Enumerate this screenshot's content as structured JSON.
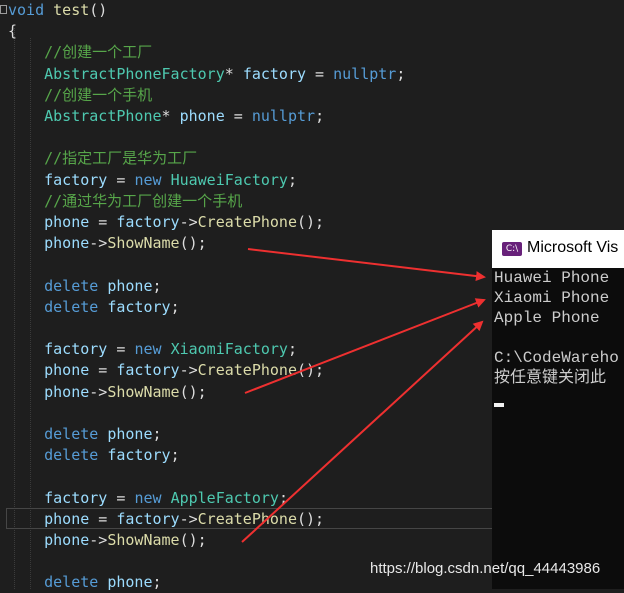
{
  "editor": {
    "lines": [
      [
        {
          "c": "kw",
          "t": "void"
        },
        {
          "c": "plain",
          "t": " "
        },
        {
          "c": "fn",
          "t": "test"
        },
        {
          "c": "plain",
          "t": "()"
        }
      ],
      [
        {
          "c": "plain",
          "t": "{"
        }
      ],
      [
        {
          "c": "plain",
          "t": "    "
        },
        {
          "c": "comment",
          "t": "//创建一个工厂"
        }
      ],
      [
        {
          "c": "plain",
          "t": "    "
        },
        {
          "c": "type",
          "t": "AbstractPhoneFactory"
        },
        {
          "c": "plain",
          "t": "* "
        },
        {
          "c": "var",
          "t": "factory"
        },
        {
          "c": "plain",
          "t": " = "
        },
        {
          "c": "kw",
          "t": "nullptr"
        },
        {
          "c": "plain",
          "t": ";"
        }
      ],
      [
        {
          "c": "plain",
          "t": "    "
        },
        {
          "c": "comment",
          "t": "//创建一个手机"
        }
      ],
      [
        {
          "c": "plain",
          "t": "    "
        },
        {
          "c": "type",
          "t": "AbstractPhone"
        },
        {
          "c": "plain",
          "t": "* "
        },
        {
          "c": "var",
          "t": "phone"
        },
        {
          "c": "plain",
          "t": " = "
        },
        {
          "c": "kw",
          "t": "nullptr"
        },
        {
          "c": "plain",
          "t": ";"
        }
      ],
      [],
      [
        {
          "c": "plain",
          "t": "    "
        },
        {
          "c": "comment",
          "t": "//指定工厂是华为工厂"
        }
      ],
      [
        {
          "c": "plain",
          "t": "    "
        },
        {
          "c": "var",
          "t": "factory"
        },
        {
          "c": "plain",
          "t": " = "
        },
        {
          "c": "kw",
          "t": "new"
        },
        {
          "c": "plain",
          "t": " "
        },
        {
          "c": "type",
          "t": "HuaweiFactory"
        },
        {
          "c": "plain",
          "t": ";"
        }
      ],
      [
        {
          "c": "plain",
          "t": "    "
        },
        {
          "c": "comment",
          "t": "//通过华为工厂创建一个手机"
        }
      ],
      [
        {
          "c": "plain",
          "t": "    "
        },
        {
          "c": "var",
          "t": "phone"
        },
        {
          "c": "plain",
          "t": " = "
        },
        {
          "c": "var",
          "t": "factory"
        },
        {
          "c": "plain",
          "t": "->"
        },
        {
          "c": "fn",
          "t": "CreatePhone"
        },
        {
          "c": "plain",
          "t": "();"
        }
      ],
      [
        {
          "c": "plain",
          "t": "    "
        },
        {
          "c": "var",
          "t": "phone"
        },
        {
          "c": "plain",
          "t": "->"
        },
        {
          "c": "fn",
          "t": "ShowName"
        },
        {
          "c": "plain",
          "t": "();"
        }
      ],
      [],
      [
        {
          "c": "plain",
          "t": "    "
        },
        {
          "c": "kw",
          "t": "delete"
        },
        {
          "c": "plain",
          "t": " "
        },
        {
          "c": "var",
          "t": "phone"
        },
        {
          "c": "plain",
          "t": ";"
        }
      ],
      [
        {
          "c": "plain",
          "t": "    "
        },
        {
          "c": "kw",
          "t": "delete"
        },
        {
          "c": "plain",
          "t": " "
        },
        {
          "c": "var",
          "t": "factory"
        },
        {
          "c": "plain",
          "t": ";"
        }
      ],
      [],
      [
        {
          "c": "plain",
          "t": "    "
        },
        {
          "c": "var",
          "t": "factory"
        },
        {
          "c": "plain",
          "t": " = "
        },
        {
          "c": "kw",
          "t": "new"
        },
        {
          "c": "plain",
          "t": " "
        },
        {
          "c": "type",
          "t": "XiaomiFactory"
        },
        {
          "c": "plain",
          "t": ";"
        }
      ],
      [
        {
          "c": "plain",
          "t": "    "
        },
        {
          "c": "var",
          "t": "phone"
        },
        {
          "c": "plain",
          "t": " = "
        },
        {
          "c": "var",
          "t": "factory"
        },
        {
          "c": "plain",
          "t": "->"
        },
        {
          "c": "fn",
          "t": "CreatePhone"
        },
        {
          "c": "plain",
          "t": "();"
        }
      ],
      [
        {
          "c": "plain",
          "t": "    "
        },
        {
          "c": "var",
          "t": "phone"
        },
        {
          "c": "plain",
          "t": "->"
        },
        {
          "c": "fn",
          "t": "ShowName"
        },
        {
          "c": "plain",
          "t": "();"
        }
      ],
      [],
      [
        {
          "c": "plain",
          "t": "    "
        },
        {
          "c": "kw",
          "t": "delete"
        },
        {
          "c": "plain",
          "t": " "
        },
        {
          "c": "var",
          "t": "phone"
        },
        {
          "c": "plain",
          "t": ";"
        }
      ],
      [
        {
          "c": "plain",
          "t": "    "
        },
        {
          "c": "kw",
          "t": "delete"
        },
        {
          "c": "plain",
          "t": " "
        },
        {
          "c": "var",
          "t": "factory"
        },
        {
          "c": "plain",
          "t": ";"
        }
      ],
      [],
      [
        {
          "c": "plain",
          "t": "    "
        },
        {
          "c": "var",
          "t": "factory"
        },
        {
          "c": "plain",
          "t": " = "
        },
        {
          "c": "kw",
          "t": "new"
        },
        {
          "c": "plain",
          "t": " "
        },
        {
          "c": "type",
          "t": "AppleFactory"
        },
        {
          "c": "plain",
          "t": ";"
        }
      ],
      [
        {
          "c": "plain",
          "t": "    "
        },
        {
          "c": "var",
          "t": "phone"
        },
        {
          "c": "plain",
          "t": " = "
        },
        {
          "c": "var",
          "t": "factory"
        },
        {
          "c": "plain",
          "t": "->"
        },
        {
          "c": "fn",
          "t": "CreatePhone"
        },
        {
          "c": "plain",
          "t": "();"
        }
      ],
      [
        {
          "c": "plain",
          "t": "    "
        },
        {
          "c": "var",
          "t": "phone"
        },
        {
          "c": "plain",
          "t": "->"
        },
        {
          "c": "fn",
          "t": "ShowName"
        },
        {
          "c": "plain",
          "t": "();"
        }
      ],
      [],
      [
        {
          "c": "plain",
          "t": "    "
        },
        {
          "c": "kw",
          "t": "delete"
        },
        {
          "c": "plain",
          "t": " "
        },
        {
          "c": "var",
          "t": "phone"
        },
        {
          "c": "plain",
          "t": ";"
        }
      ]
    ]
  },
  "console": {
    "icon_label": "C:\\",
    "title": "Microsoft Vis",
    "output": [
      "Huawei Phone",
      "Xiaomi Phone",
      "Apple Phone",
      "",
      "C:\\CodeWareho",
      "按任意键关闭此"
    ]
  },
  "watermark": "https://blog.csdn.net/qq_44443986",
  "colors": {
    "editor_bg": "#1e1e1e",
    "keyword": "#569cd6",
    "type": "#4ec9b0",
    "function": "#dcdcaa",
    "variable": "#9cdcfe",
    "comment": "#57a64a",
    "console_bg": "#0c0c0c",
    "arrow": "#ee3030"
  }
}
